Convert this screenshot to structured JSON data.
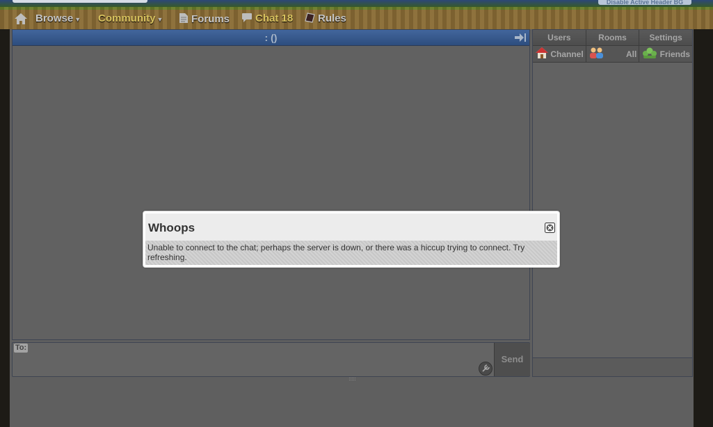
{
  "header": {
    "disable_bg_label": "Disable Active Header BG"
  },
  "nav": {
    "browse": "Browse",
    "community": "Community",
    "forums": "Forums",
    "chat": "Chat 18",
    "rules": "Rules"
  },
  "chat": {
    "title": ": ()",
    "to_label": "To:",
    "message_value": "",
    "send_label": "Send"
  },
  "side": {
    "tabs": [
      {
        "label": "Users"
      },
      {
        "label": "Rooms"
      },
      {
        "label": "Settings"
      }
    ],
    "filters": [
      {
        "label": "Channel",
        "icon": "house-icon"
      },
      {
        "label": "All",
        "icon": "people-icon"
      },
      {
        "label": "Friends",
        "icon": "friends-icon"
      }
    ]
  },
  "modal": {
    "title": "Whoops",
    "message": "Unable to connect to the chat; perhaps the server is down, or there was a hiccup trying to connect. Try refreshing."
  },
  "colors": {
    "title_bar": "#42669c",
    "nav_gold": "#d8c25e",
    "page_bg": "#5f5f5f"
  }
}
